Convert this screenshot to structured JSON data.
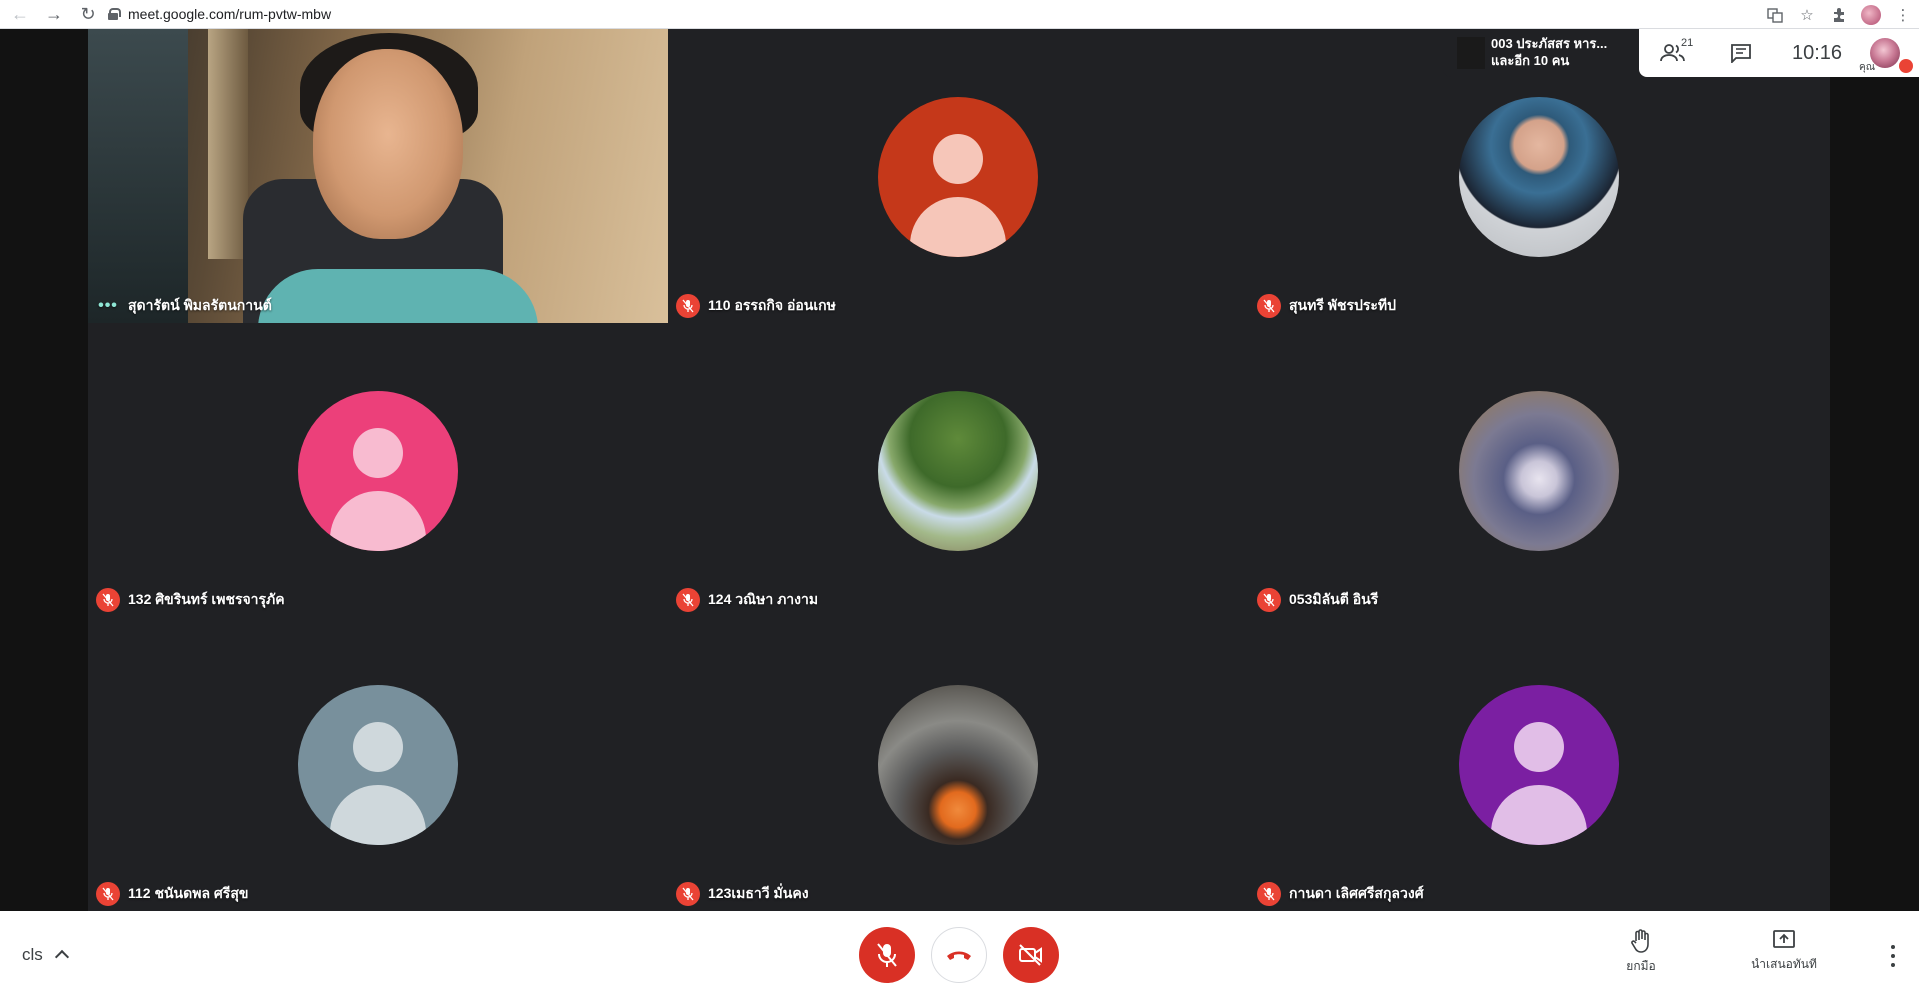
{
  "browser": {
    "url": "meet.google.com/rum-pvtw-mbw",
    "icons": [
      "back-icon",
      "forward-icon",
      "reload-icon",
      "lock-icon",
      "translate-icon",
      "star-icon",
      "extensions-icon",
      "menu-icon"
    ]
  },
  "meeting_header": {
    "presenter_line1": "003 ประภัสสร หาร...",
    "presenter_line2": "และอีก 10 คน",
    "people_count": "21",
    "time": "10:16",
    "self_label": "คุณ"
  },
  "participants": [
    {
      "name": "สุดารัตน์ พิมลรัตนกานต์",
      "type": "video",
      "status": "speaking"
    },
    {
      "name": "110 อรรถกิจ อ่อนเกษ",
      "type": "avatar",
      "color": "#c5381a",
      "status": "muted"
    },
    {
      "name": "สุนทรี พัชรประทีป",
      "type": "photo",
      "status": "muted"
    },
    {
      "name": "132 ศิขรินทร์ เพชรจารุภัค",
      "type": "avatar",
      "color": "#ec407a",
      "status": "muted"
    },
    {
      "name": "124 วณิษา ภางาม",
      "type": "photo",
      "status": "muted"
    },
    {
      "name": "053มิลันตี อินรี",
      "type": "photo",
      "status": "muted"
    },
    {
      "name": "112 ชนันดพล ศรีสุข",
      "type": "avatar",
      "color": "#78909c",
      "status": "muted"
    },
    {
      "name": "123เมธาวี มั่นคง",
      "type": "photo",
      "status": "muted"
    },
    {
      "name": "กานดา เลิศศรีสกุลวงศ์",
      "type": "avatar",
      "color": "#7b1fa2",
      "status": "muted"
    }
  ],
  "bottom_bar": {
    "meeting_code": "cls",
    "raise_hand_label": "ยกมือ",
    "present_label": "นำเสนอทันที"
  },
  "colors": {
    "stage_bg": "#202124",
    "mute_red": "#ea4335",
    "control_red": "#d93025"
  }
}
